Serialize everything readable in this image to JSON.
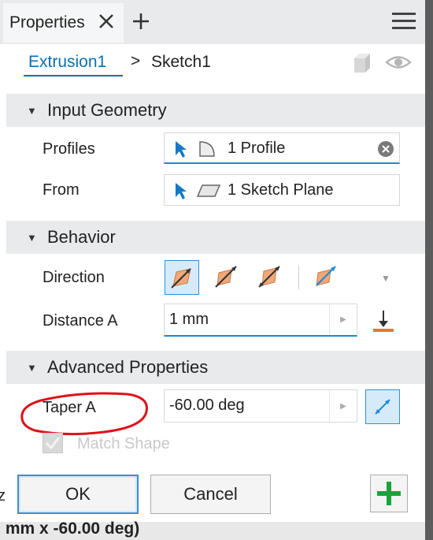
{
  "tab": {
    "label": "Properties"
  },
  "breadcrumb": {
    "parent": "Extrusion1",
    "separator": ">",
    "current": "Sketch1"
  },
  "sections": {
    "input_geometry": {
      "title": "Input Geometry",
      "profiles": {
        "label": "Profiles",
        "value": "1 Profile"
      },
      "from": {
        "label": "From",
        "value": "1 Sketch Plane"
      }
    },
    "behavior": {
      "title": "Behavior",
      "direction": {
        "label": "Direction"
      },
      "distance_a": {
        "label": "Distance A",
        "value": "1 mm"
      }
    },
    "advanced": {
      "title": "Advanced Properties",
      "taper_a": {
        "label": "Taper A",
        "value": "-60.00 deg"
      },
      "match_shape": {
        "label": "Match Shape",
        "checked": true,
        "disabled": true
      }
    }
  },
  "footer": {
    "ok_label": "OK",
    "cancel_label": "Cancel"
  },
  "background_text": {
    "bottom": ": mm x -60.00 deg)",
    "left_edge": "z"
  },
  "colors": {
    "accent": "#1b8ad3",
    "link": "#0a6fb5",
    "annotation": "#e0101a",
    "plus_green": "#1aa33a",
    "plane_orange": "#f0a878"
  },
  "icons": [
    "close-icon",
    "add-icon",
    "hamburger-menu-icon",
    "cube-icon",
    "eye-icon",
    "cursor-icon",
    "profile-icon",
    "plane-icon",
    "clear-icon",
    "flip-icon",
    "spinner-icon",
    "measure-icon",
    "plus-icon"
  ]
}
